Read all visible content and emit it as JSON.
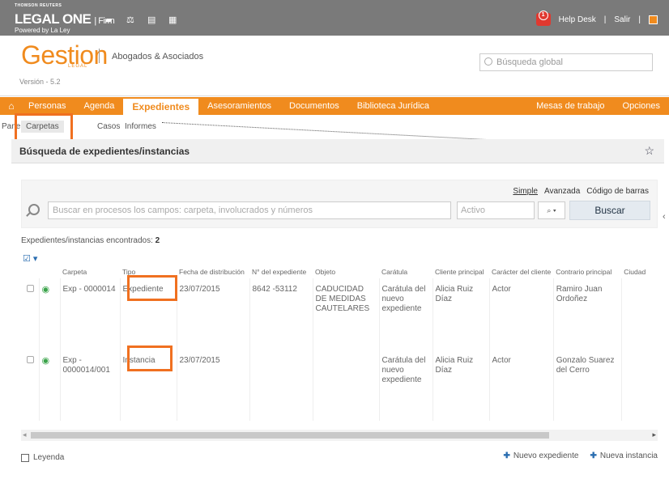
{
  "topbar": {
    "company": "THOMSON REUTERS",
    "brand": "LEGAL ONE",
    "brand_suffix": "| Firm",
    "powered_by": "Powered by La Ley",
    "notification_count": "1",
    "help_desk": "Help Desk",
    "logout": "Salir"
  },
  "header": {
    "product": "Gestion",
    "product_sub": "LEGAL",
    "firm": "Abogados & Asociados",
    "version": "Versión - 5.2",
    "global_search_placeholder": "Búsqueda global"
  },
  "nav": {
    "items": [
      "Personas",
      "Agenda",
      "Expedientes",
      "Asesoramientos",
      "Documentos",
      "Biblioteca Jurídica"
    ],
    "right": [
      "Mesas de trabajo",
      "Opciones"
    ]
  },
  "subnav": {
    "items": [
      "Panel",
      "Carpetas",
      "Casos",
      "Informes"
    ]
  },
  "panel": {
    "title": "Búsqueda de expedientes/instancias"
  },
  "search": {
    "modes": [
      "Simple",
      "Avanzada",
      "Código de barras"
    ],
    "placeholder": "Buscar en procesos los campos: carpeta, involucrados y números",
    "state_value": "Activo",
    "button": "Buscar"
  },
  "results": {
    "label": "Expedientes/instancias encontrados:",
    "count": "2",
    "columns": [
      "Carpeta",
      "Tipo",
      "Fecha de distribución",
      "N° del expediente",
      "Objeto",
      "Carátula",
      "Cliente principal",
      "Carácter del cliente",
      "Contrario principal",
      "Ciudad"
    ],
    "rows": [
      {
        "carpeta": "Exp - 0000014",
        "tipo": "Expediente",
        "fecha": "23/07/2015",
        "numero": "8642 -53112",
        "objeto": "CADUCIDAD DE MEDIDAS CAUTELARES",
        "caratula": "Carátula del nuevo expediente",
        "cliente": "Alicia Ruiz Díaz",
        "caracter": "Actor",
        "contrario": "Ramiro Juan Ordoñez",
        "ciudad": ""
      },
      {
        "carpeta": "Exp - 0000014/001",
        "tipo": "Instancia",
        "fecha": "23/07/2015",
        "numero": "",
        "objeto": "",
        "caratula": "Carátula del nuevo expediente",
        "cliente": "Alicia Ruiz Díaz",
        "caracter": "Actor",
        "contrario": "Gonzalo Suarez del Cerro",
        "ciudad": ""
      }
    ]
  },
  "footer": {
    "legend": "Leyenda",
    "new_expediente": "Nuevo expediente",
    "new_instancia": "Nueva instancia"
  },
  "colors": {
    "accent": "#f08b1e",
    "highlight": "#f07020",
    "topbar": "#7a7a7a"
  }
}
